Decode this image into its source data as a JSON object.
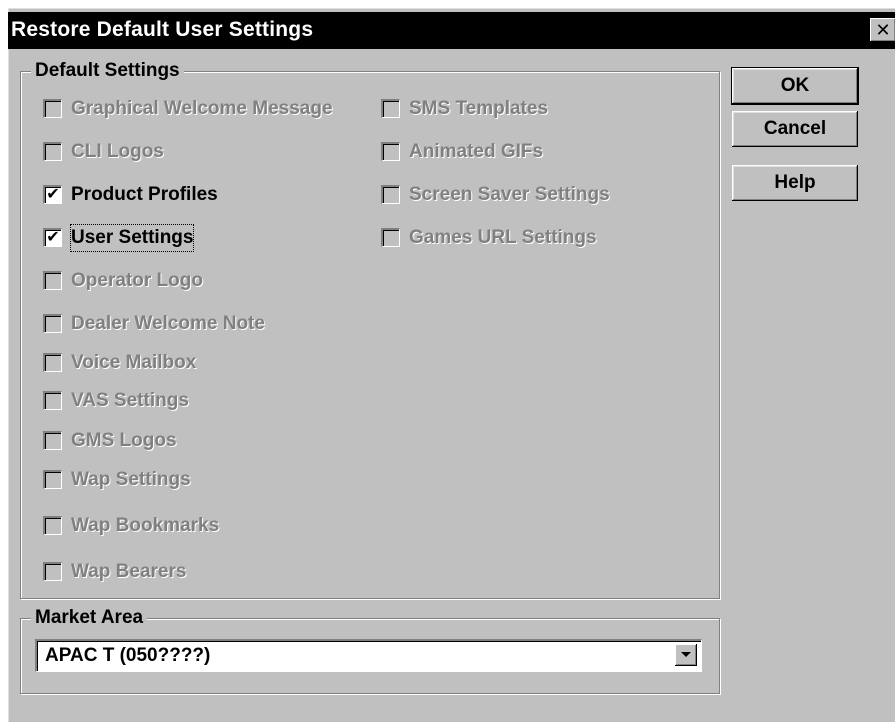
{
  "dialog": {
    "title": "Restore Default User Settings",
    "close_glyph": "✕"
  },
  "default_settings": {
    "title": "Default Settings",
    "left_column": [
      {
        "label": "Graphical Welcome Message",
        "checked": false,
        "enabled": false
      },
      {
        "label": "CLI Logos",
        "checked": false,
        "enabled": false
      },
      {
        "label": "Product Profiles",
        "checked": true,
        "enabled": true
      },
      {
        "label": "User Settings",
        "checked": true,
        "enabled": true,
        "focused": true
      },
      {
        "label": "Operator Logo",
        "checked": false,
        "enabled": false
      },
      {
        "label": "Dealer Welcome Note",
        "checked": false,
        "enabled": false
      },
      {
        "label": "Voice Mailbox",
        "checked": false,
        "enabled": false
      },
      {
        "label": "VAS Settings",
        "checked": false,
        "enabled": false
      },
      {
        "label": "GMS Logos",
        "checked": false,
        "enabled": false
      },
      {
        "label": "Wap Settings",
        "checked": false,
        "enabled": false
      },
      {
        "label": "Wap Bookmarks",
        "checked": false,
        "enabled": false
      },
      {
        "label": "Wap Bearers",
        "checked": false,
        "enabled": false
      }
    ],
    "right_column": [
      {
        "label": "SMS Templates",
        "checked": false,
        "enabled": false
      },
      {
        "label": "Animated GIFs",
        "checked": false,
        "enabled": false
      },
      {
        "label": "Screen Saver Settings",
        "checked": false,
        "enabled": false
      },
      {
        "label": "Games URL Settings",
        "checked": false,
        "enabled": false
      }
    ]
  },
  "buttons": {
    "ok": "OK",
    "cancel": "Cancel",
    "help": "Help"
  },
  "market_area": {
    "title": "Market Area",
    "selected": "APAC T (050????)"
  },
  "colors": {
    "face": "#c0c0c0",
    "title_bar": "#000000",
    "disabled_text": "#808080"
  }
}
